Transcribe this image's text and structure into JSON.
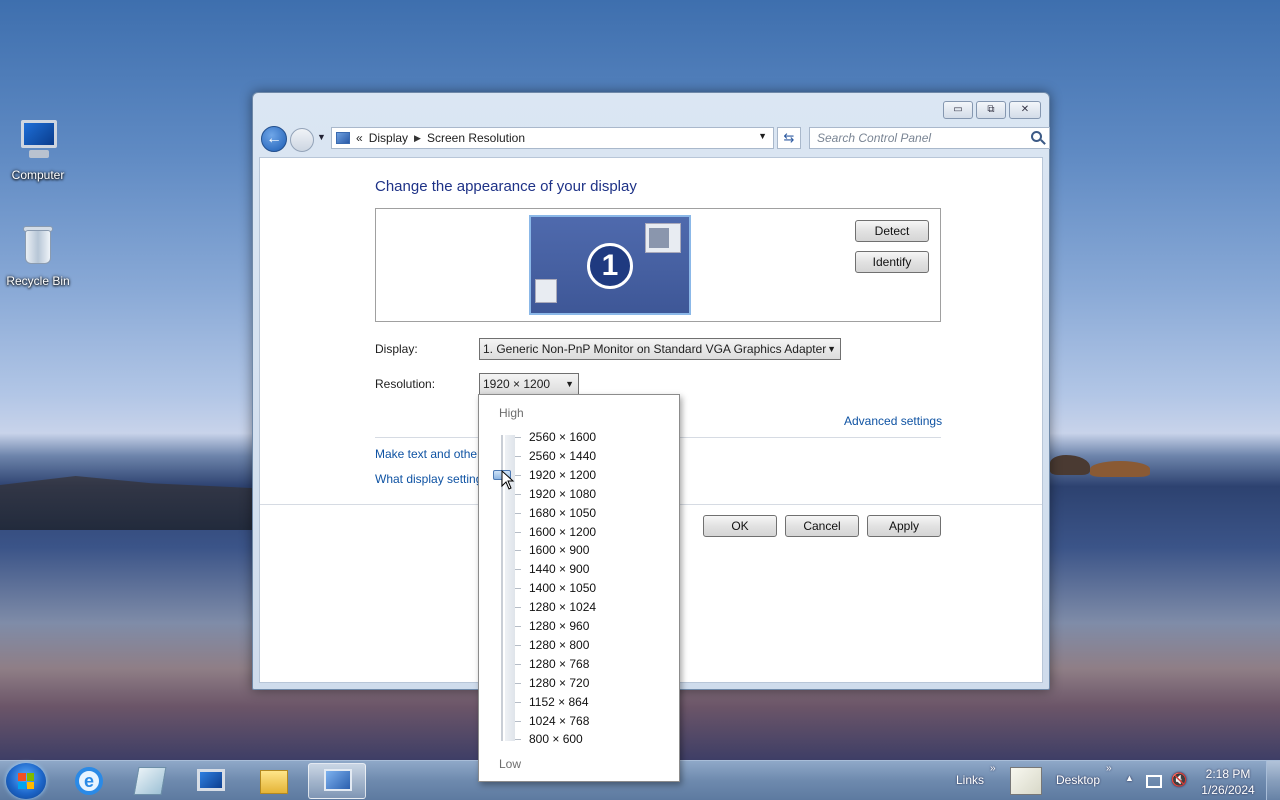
{
  "desktop": {
    "icons": [
      {
        "label": "Computer"
      },
      {
        "label": "Recycle Bin"
      }
    ]
  },
  "window": {
    "controls": {
      "minimize": "▭",
      "maximize": "⧉",
      "close": "✕"
    },
    "nav": {
      "back": "←",
      "breadcrumb_root": "«",
      "breadcrumb": [
        "Display",
        "Screen Resolution"
      ],
      "search_placeholder": "Search Control Panel"
    },
    "content": {
      "title": "Change the appearance of your display",
      "monitor_number": "1",
      "detect_label": "Detect",
      "identify_label": "Identify",
      "display_label": "Display:",
      "display_value": "1. Generic Non-PnP Monitor on Standard VGA Graphics Adapter",
      "resolution_label": "Resolution:",
      "resolution_value": "1920 × 1200",
      "advanced_link": "Advanced settings",
      "link_text_size": "Make text and other",
      "link_what_settings": "What display setting",
      "ok_label": "OK",
      "cancel_label": "Cancel",
      "apply_label": "Apply"
    }
  },
  "dropdown": {
    "high_label": "High",
    "low_label": "Low",
    "selected": "1920 × 1200",
    "options": [
      "2560 × 1600",
      "2560 × 1440",
      "1920 × 1200",
      "1920 × 1080",
      "1680 × 1050",
      "1600 × 1200",
      "1600 × 900",
      "1440 × 900",
      "1400 × 1050",
      "1280 × 1024",
      "1280 × 960",
      "1280 × 800",
      "1280 × 768",
      "1280 × 720",
      "1152 × 864",
      "1024 × 768",
      "800 × 600"
    ]
  },
  "taskbar": {
    "links_label": "Links",
    "desktop_label": "Desktop",
    "chevron": "»",
    "time": "2:18 PM",
    "date": "1/26/2024"
  },
  "colors": {
    "link": "#0f53a3",
    "title": "#1e3287",
    "monitor_fill": "#4f6aad",
    "taskbar": "#6e8aae"
  }
}
